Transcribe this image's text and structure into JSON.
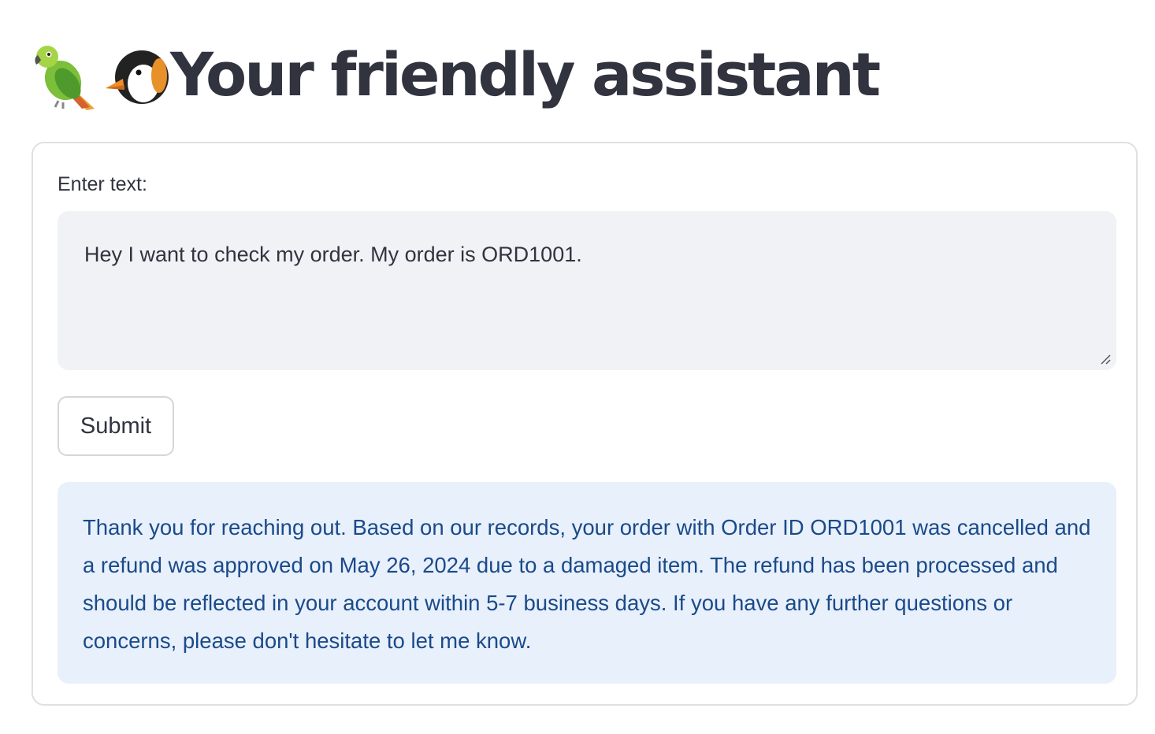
{
  "header": {
    "emoji_1": "parrot-icon",
    "emoji_2": "penguin-icon",
    "title": "Your friendly assistant"
  },
  "form": {
    "label": "Enter text:",
    "input_value": "Hey I want to check my order. My order is ORD1001.",
    "submit_label": "Submit"
  },
  "response": {
    "text": "Thank you for reaching out. Based on our records, your order with Order ID ORD1001 was cancelled and a refund was approved on May 26, 2024 due to a damaged item. The refund has been processed and should be reflected in your account within 5-7 business days. If you have any further questions or concerns, please don't hesitate to let me know."
  },
  "colors": {
    "text": "#31333f",
    "input_bg": "#f0f2f6",
    "response_bg": "#e8f0fb",
    "response_text": "#1a4a8a",
    "border": "#e0e0e3"
  }
}
